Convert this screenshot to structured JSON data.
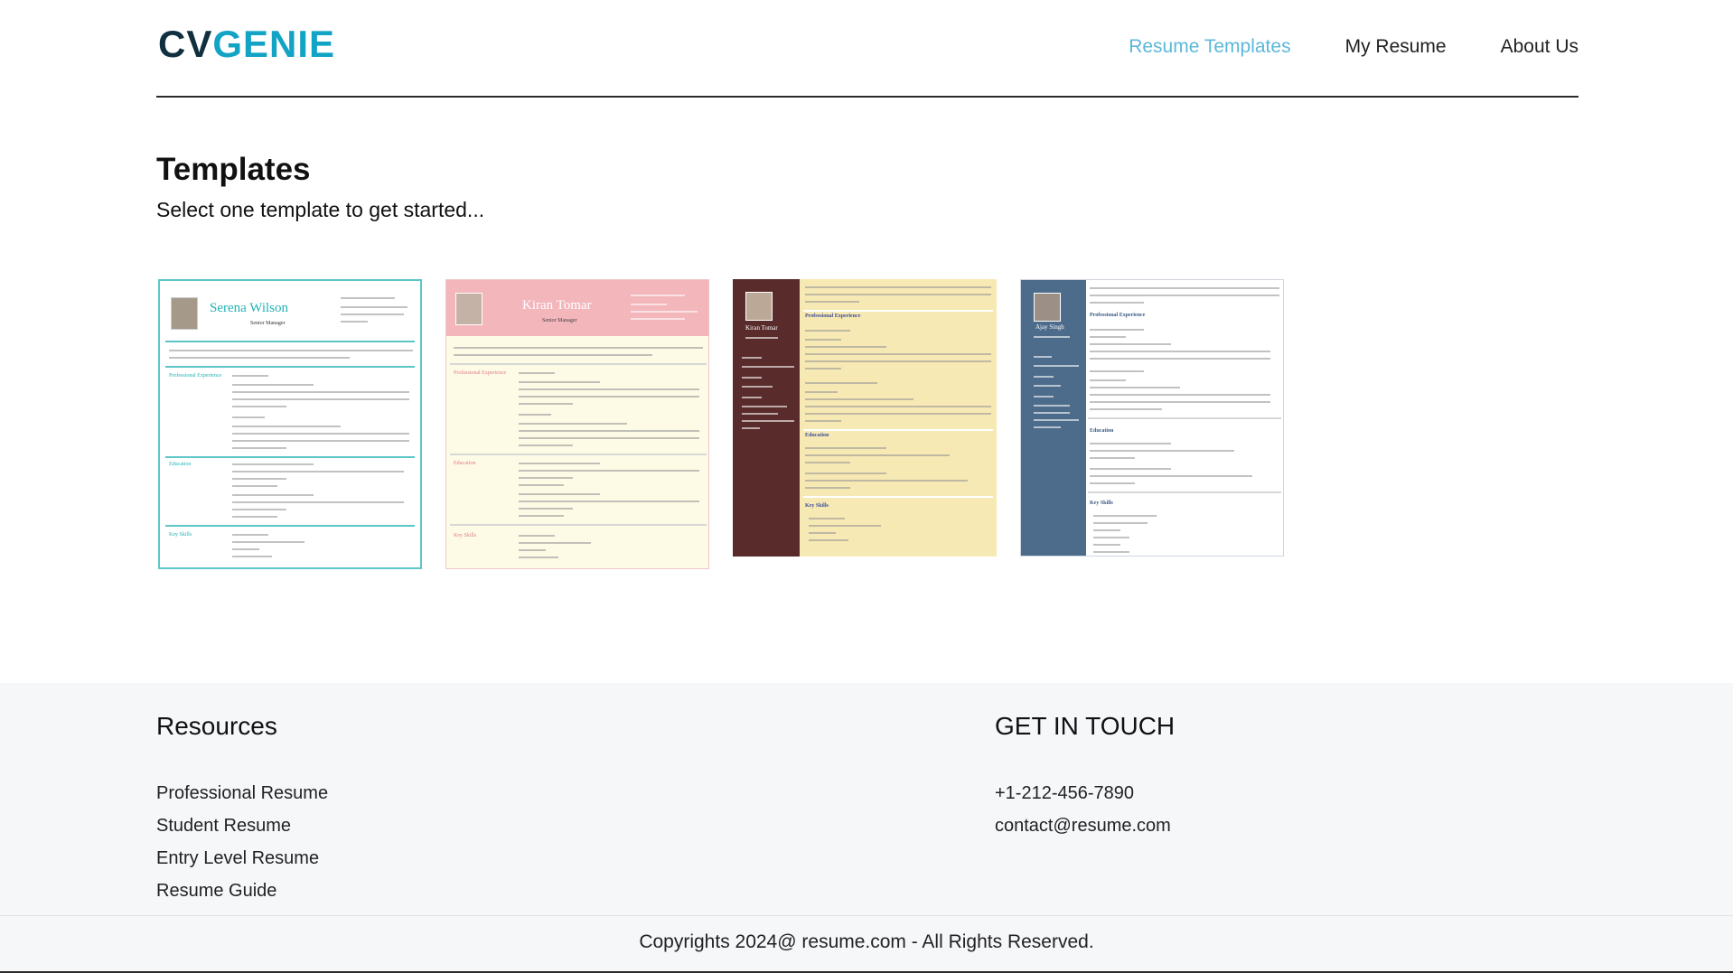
{
  "header": {
    "logo_part1": "CV",
    "logo_part2": "GENIE",
    "nav": [
      {
        "label": "Resume Templates",
        "active": true
      },
      {
        "label": "My Resume",
        "active": false
      },
      {
        "label": "About Us",
        "active": false
      }
    ]
  },
  "templates_section": {
    "title": "Templates",
    "subtitle": "Select one template to get started...",
    "templates": [
      {
        "name": "Serena Wilson",
        "role": "Senior Manager",
        "sections": [
          "Professional Experience",
          "Education",
          "Key Skills"
        ],
        "accent": "#23b3b7"
      },
      {
        "name": "Kiran Tomar",
        "role": "Senior Manager",
        "sections": [
          "Professional Experience",
          "Education",
          "Key Skills"
        ],
        "accent": "#f2b6bb"
      },
      {
        "name": "Kiran Tomar",
        "role": "Senior Manager",
        "sections": [
          "Professional Experience",
          "Education",
          "Key Skills"
        ],
        "accent": "#5a2b2b"
      },
      {
        "name": "Ajay Singh",
        "role": "Senior manager",
        "sections": [
          "Professional Experience",
          "Education",
          "Key Skills"
        ],
        "accent": "#4d6b8a"
      }
    ]
  },
  "footer": {
    "resources_title": "Resources",
    "resources": [
      "Professional Resume",
      "Student Resume",
      "Entry Level Resume",
      "Resume Guide"
    ],
    "contact_title": "GET IN TOUCH",
    "contact": [
      "+1-212-456-7890",
      "contact@resume.com"
    ],
    "copyright": "Copyrights 2024@ resume.com - All Rights Reserved."
  },
  "colors": {
    "brand_dark": "#10303f",
    "brand_accent": "#13a3c4",
    "nav_active": "#5cb8d8"
  }
}
